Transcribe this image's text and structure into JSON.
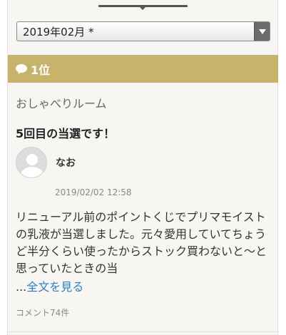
{
  "month_select": {
    "value": "2019年02月 *"
  },
  "rank": {
    "label": "1位",
    "icon": "speech-bubble-icon"
  },
  "post": {
    "category": "おしゃべりルーム",
    "title": "5回目の当選です！",
    "username": "なお",
    "timestamp": "2019/02/02 12:58",
    "body": "リニューアル前のポイントくじでプリマモイストの乳液が当選しました。元々愛用していてちょうど半分くらい使ったからストック買わないと〜と思っていたときの当",
    "ellipsis": "...",
    "read_more": "全文を見る",
    "comments": "コメント74件"
  },
  "colors": {
    "rank_bar": "#c7b46a",
    "link": "#2a7fc4",
    "background": "#f7f6f2"
  }
}
